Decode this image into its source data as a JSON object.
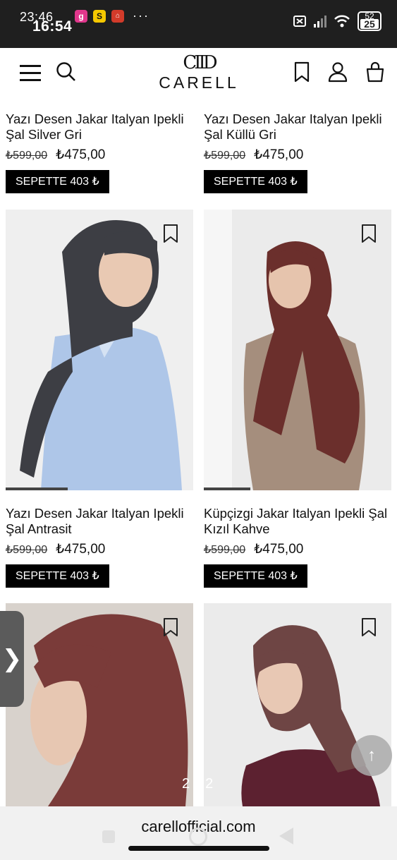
{
  "status_bar": {
    "time_back": "23:46",
    "time_front": "16:54",
    "notif_icons": [
      "g",
      "S",
      "home"
    ],
    "more": "···",
    "battery_top": "52",
    "battery_level": "25"
  },
  "header": {
    "logo_mark": "CIID",
    "logo_text": "CARELL"
  },
  "products": [
    {
      "name": "Yazı Desen Jakar Italyan Ipekli Şal Silver Gri",
      "old_price": "₺599,00",
      "price": "₺475,00",
      "cart_label": "SEPETTE 403 ₺"
    },
    {
      "name": "Yazı Desen Jakar Italyan Ipekli Şal Küllü Gri",
      "old_price": "₺599,00",
      "price": "₺475,00",
      "cart_label": "SEPETTE 403 ₺"
    },
    {
      "name": "Yazı Desen Jakar Italyan Ipekli Şal Antrasit",
      "old_price": "₺599,00",
      "price": "₺475,00",
      "cart_label": "SEPETTE 403 ₺"
    },
    {
      "name": "Küpçizgi Jakar Italyan Ipekli Şal Kızıl Kahve",
      "old_price": "₺599,00",
      "price": "₺475,00",
      "cart_label": "SEPETTE 403 ₺"
    }
  ],
  "side_tab_label": "❯",
  "scroll_top_icon": "↑",
  "page_indicator": "22",
  "browser": {
    "url": "carellofficial.com"
  },
  "colors": {
    "accent": "#000000",
    "status_bar": "#1f1f1f"
  }
}
